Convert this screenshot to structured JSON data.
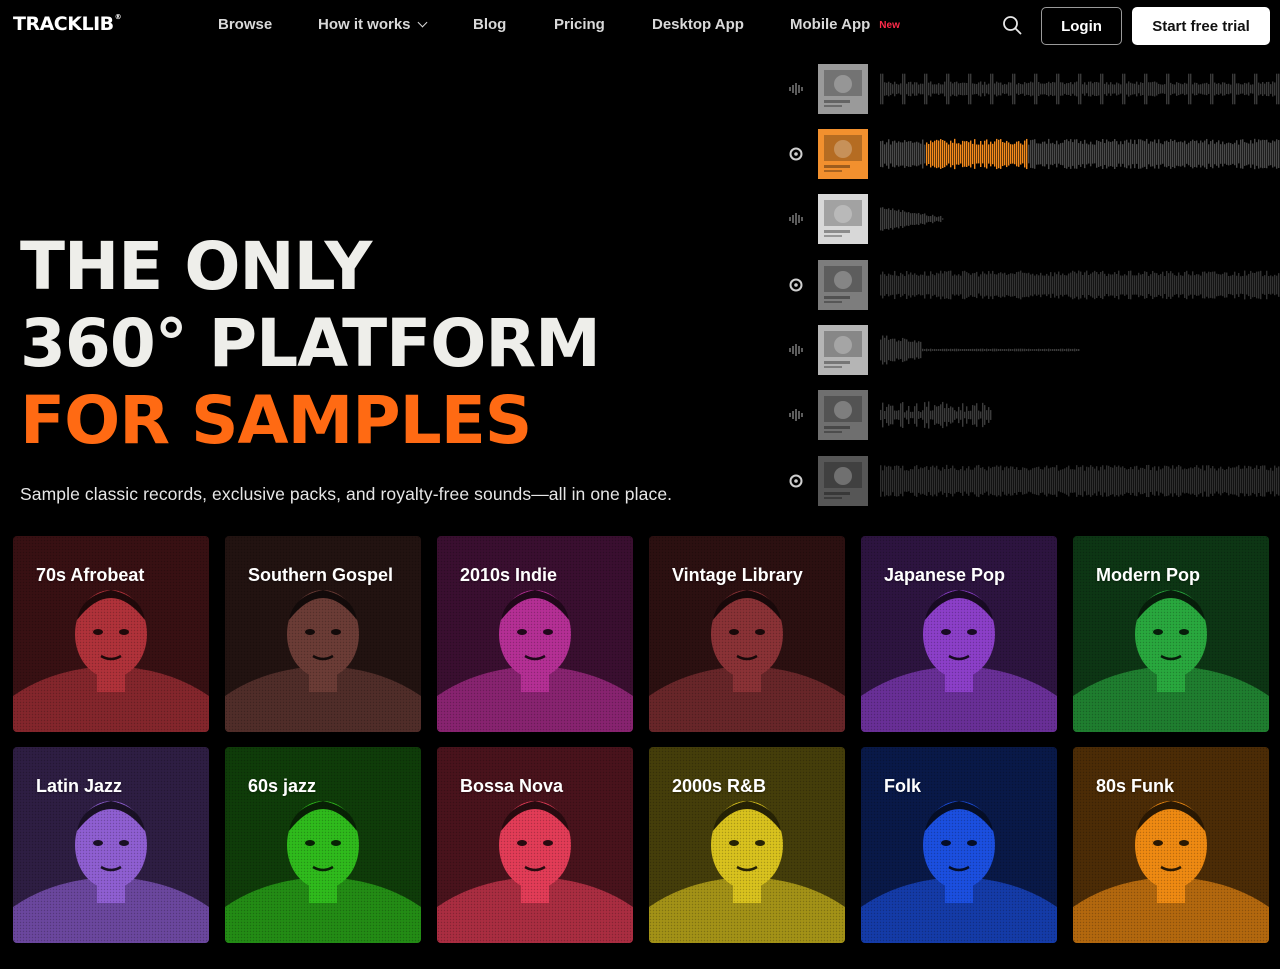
{
  "brand": {
    "logo_text": "TRACKLIB",
    "logo_mark": "®"
  },
  "nav": {
    "links": [
      {
        "label": "Browse"
      },
      {
        "label": "How it works",
        "has_dropdown": true
      },
      {
        "label": "Blog"
      },
      {
        "label": "Pricing"
      },
      {
        "label": "Desktop App"
      },
      {
        "label": "Mobile App",
        "badge": "New"
      }
    ],
    "search_icon": "search-icon",
    "login_label": "Login",
    "trial_label": "Start free trial"
  },
  "hero": {
    "line1": "THE ONLY",
    "line2": "360° PLATFORM",
    "line3": "FOR SAMPLES",
    "subtitle": "Sample classic records, exclusive packs, and royalty-free sounds—all in one place."
  },
  "tracks": [
    {
      "control_icon": "waveform-icon",
      "cover_color": "#9a9a9a"
    },
    {
      "control_icon": "play-icon",
      "cover_color": "#f2902e",
      "progress": 0.37,
      "active": true
    },
    {
      "control_icon": "waveform-icon",
      "cover_color": "#d8d8d8"
    },
    {
      "control_icon": "play-icon",
      "cover_color": "#7d7d7d"
    },
    {
      "control_icon": "waveform-icon",
      "cover_color": "#b5b5b5"
    },
    {
      "control_icon": "waveform-icon",
      "cover_color": "#6f6f6f"
    },
    {
      "control_icon": "play-icon",
      "cover_color": "#565656"
    }
  ],
  "genres": [
    {
      "label": "70s Afrobeat",
      "color": "#b0323a"
    },
    {
      "label": "Southern Gospel",
      "color": "#6b3c36"
    },
    {
      "label": "2010s Indie",
      "color": "#b52f95"
    },
    {
      "label": "Vintage Library",
      "color": "#8a3236"
    },
    {
      "label": "Japanese Pop",
      "color": "#8c3fc9"
    },
    {
      "label": "Modern Pop",
      "color": "#29a83e"
    },
    {
      "label": "Latin Jazz",
      "color": "#8f5fd2"
    },
    {
      "label": "60s jazz",
      "color": "#2fbb1c"
    },
    {
      "label": "Bossa Nova",
      "color": "#e33c57"
    },
    {
      "label": "2000s R&B",
      "color": "#d9c21e"
    },
    {
      "label": "Folk",
      "color": "#1b4fe0"
    },
    {
      "label": "80s Funk",
      "color": "#ef8a12"
    }
  ]
}
